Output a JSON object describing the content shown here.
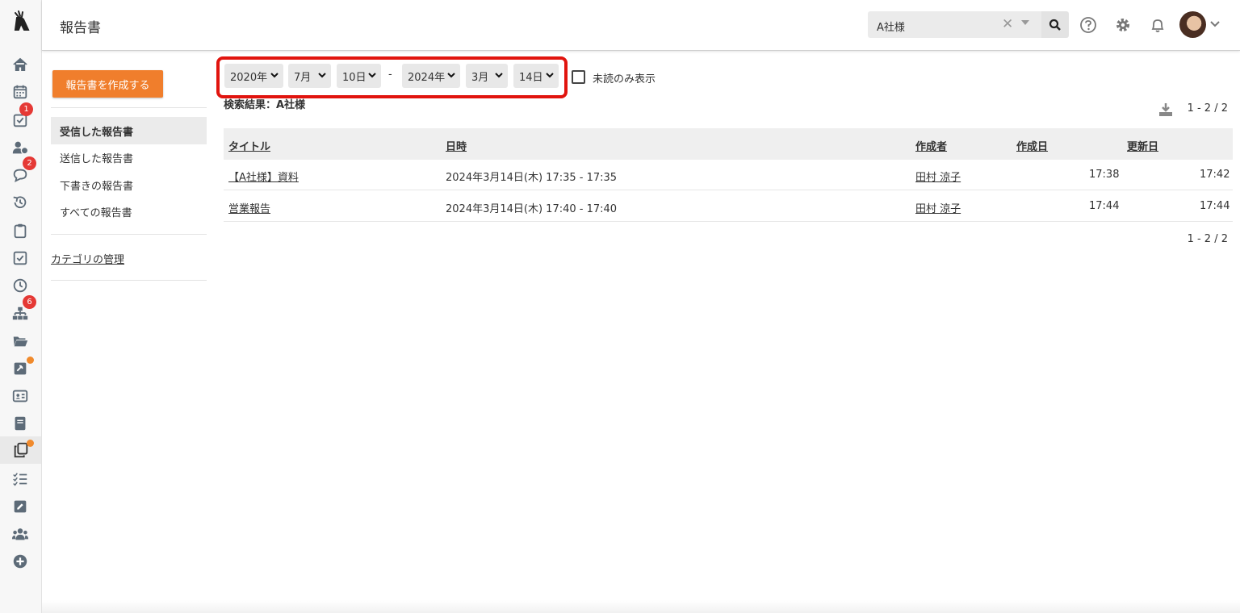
{
  "header": {
    "title": "報告書",
    "search_value": "A社様"
  },
  "rail": {
    "items": [
      {
        "icon": "home-icon",
        "badge": ""
      },
      {
        "icon": "calendar-icon",
        "badge": ""
      },
      {
        "icon": "todo-check-icon",
        "badge": "1"
      },
      {
        "icon": "user-clock-icon",
        "badge": ""
      },
      {
        "icon": "chat-bubble-icon",
        "badge": "2"
      },
      {
        "icon": "history-icon",
        "badge": ""
      },
      {
        "icon": "clipboard-icon",
        "badge": ""
      },
      {
        "icon": "checkbox-icon",
        "badge": ""
      },
      {
        "icon": "clock-icon",
        "badge": ""
      },
      {
        "icon": "org-chart-icon",
        "badge": "6"
      },
      {
        "icon": "folder-open-icon",
        "badge": ""
      },
      {
        "icon": "phone-note-icon",
        "badge": "dot"
      },
      {
        "icon": "id-card-icon",
        "badge": ""
      },
      {
        "icon": "book-icon",
        "badge": ""
      },
      {
        "icon": "reports-copy-icon",
        "badge": "dot"
      },
      {
        "icon": "task-list-icon",
        "badge": ""
      },
      {
        "icon": "edit-square-icon",
        "badge": ""
      },
      {
        "icon": "users-group-icon",
        "badge": ""
      },
      {
        "icon": "plus-circle-icon",
        "badge": ""
      }
    ]
  },
  "sidebar": {
    "create_label": "報告書を作成する",
    "items": [
      {
        "label": "受信した報告書"
      },
      {
        "label": "送信した報告書"
      },
      {
        "label": "下書きの報告書"
      },
      {
        "label": "すべての報告書"
      }
    ],
    "category_link": "カテゴリの管理"
  },
  "filters": {
    "from_year": "2020年",
    "from_month": "7月",
    "from_day": "10日",
    "separator": "-",
    "to_year": "2024年",
    "to_month": "3月",
    "to_day": "14日",
    "unread_label": "未読のみ表示"
  },
  "results": {
    "label": "検索結果：A社様",
    "pager": "1 - 2 / 2",
    "columns": [
      "タイトル",
      "日時",
      "作成者",
      "作成日",
      "更新日"
    ],
    "rows": [
      {
        "title": "【A社様】資料",
        "datetime": "2024年3月14日(木) 17:35 - 17:35",
        "author": "田村 涼子",
        "created": "17:38",
        "updated": "17:42"
      },
      {
        "title": "営業報告",
        "datetime": "2024年3月14日(木) 17:40 - 17:40",
        "author": "田村 涼子",
        "created": "17:44",
        "updated": "17:44"
      }
    ]
  },
  "colors": {
    "accent": "#f07e2c",
    "highlight": "#e1140e",
    "badge": "#e53935"
  }
}
